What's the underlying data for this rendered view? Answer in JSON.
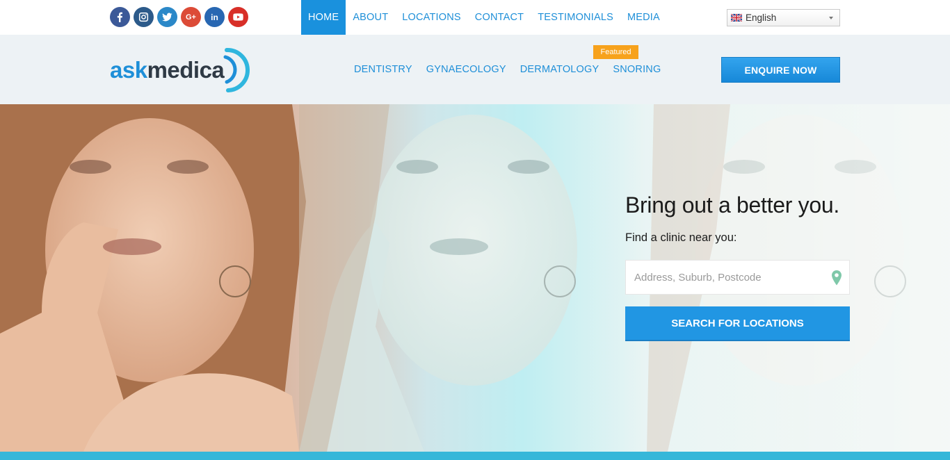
{
  "social": [
    {
      "name": "facebook-icon",
      "glyph": "f",
      "color": "#3b5998"
    },
    {
      "name": "instagram-icon",
      "glyph": "",
      "color": "#2c5a8a"
    },
    {
      "name": "twitter-icon",
      "glyph": "",
      "color": "#2b88c8"
    },
    {
      "name": "google-plus-icon",
      "glyph": "G+",
      "color": "#dc4b37"
    },
    {
      "name": "linkedin-icon",
      "glyph": "in",
      "color": "#2867b2"
    },
    {
      "name": "youtube-icon",
      "glyph": "",
      "color": "#d82f28"
    }
  ],
  "topnav": {
    "home": "HOME",
    "about": "ABOUT",
    "locations": "LOCATIONS",
    "contact": "CONTACT",
    "testimonials": "TESTIMONIALS",
    "media": "MEDIA"
  },
  "language": {
    "selected": "English"
  },
  "logo": {
    "part1": "ask",
    "part2": "medica"
  },
  "subnav": {
    "dentistry": "DENTISTRY",
    "gynaecology": "GYNAECOLOGY",
    "dermatology": "DERMATOLOGY",
    "snoring": "SNORING",
    "featured_badge": "Featured"
  },
  "header": {
    "enquire": "ENQUIRE NOW"
  },
  "hero": {
    "title": "Bring out a better you.",
    "subtitle": "Find a clinic near you:",
    "search_placeholder": "Address, Suburb, Postcode",
    "search_button": "SEARCH FOR LOCATIONS"
  },
  "colors": {
    "brand_blue": "#1e8fd8",
    "accent_orange": "#f7a21c",
    "strip": "#36b7d9"
  }
}
